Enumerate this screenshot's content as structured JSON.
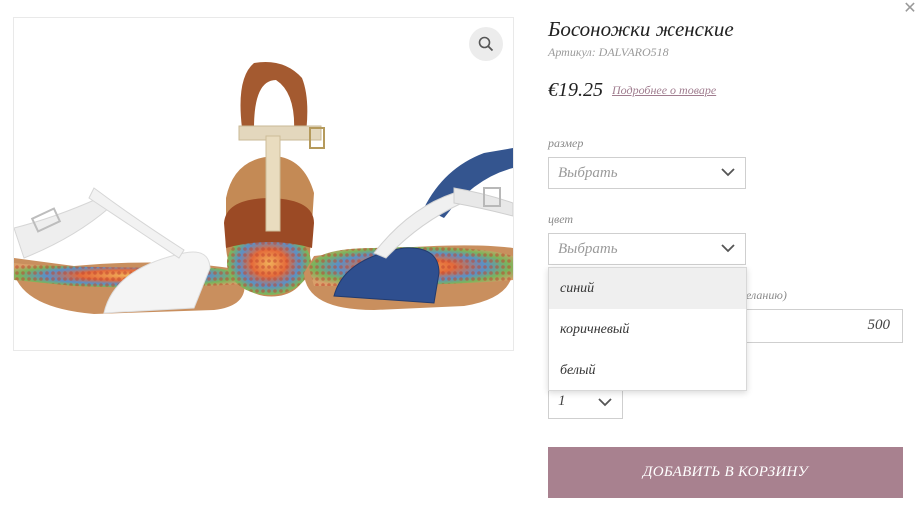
{
  "product": {
    "title": "Босоножки женские",
    "sku": "Артикул: DALVARO518",
    "price": "€19.25",
    "more_link": "Подробнее о товаре"
  },
  "size": {
    "label": "размер",
    "value": "Выбрать"
  },
  "color": {
    "label": "цвет",
    "value": "Выбрать",
    "options": [
      "синий",
      "коричневый",
      "белый"
    ],
    "highlighted": "синий"
  },
  "custom_field": {
    "partial_label": "желанию)",
    "value": "500"
  },
  "quantity": {
    "value": "1"
  },
  "cart_button": "ДОБАВИТЬ В КОРЗИНУ",
  "colors": {
    "accent": "#a8818f",
    "link": "#a07d8f"
  },
  "icons": [
    "close-icon",
    "zoom-icon",
    "chevron-down-icon"
  ]
}
